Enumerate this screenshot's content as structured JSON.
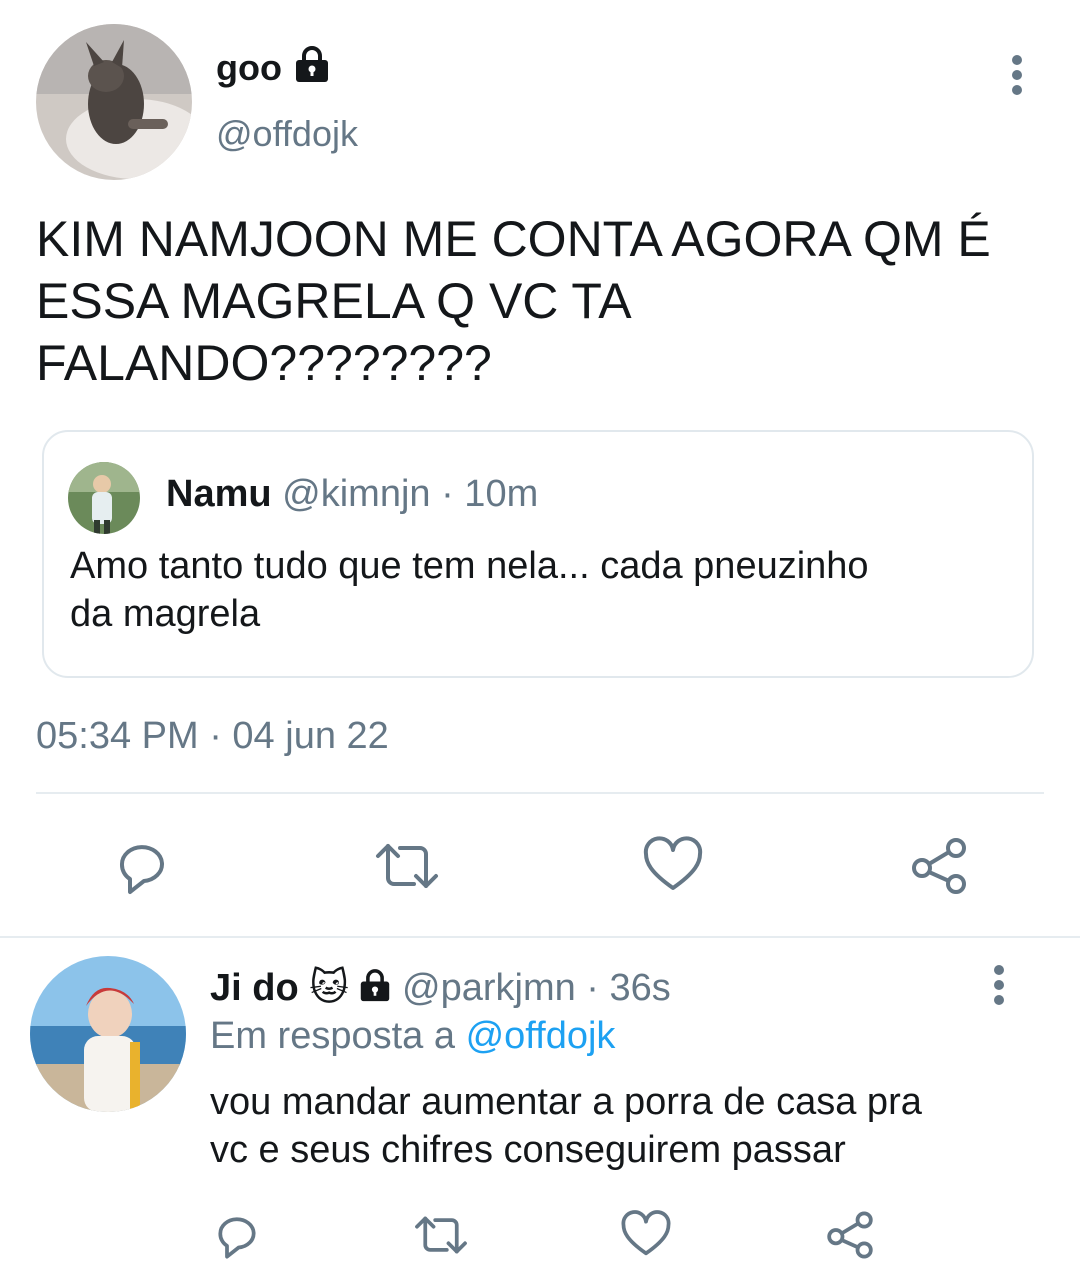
{
  "main_tweet": {
    "display_name": "goo",
    "handle": "@offdojk",
    "text_lines": [
      "KIM NAMJOON ME CONTA AGORA QM É",
      "ESSA MAGRELA Q VC TA",
      "FALANDO????????"
    ],
    "timestamp": "05:34 PM · 04 jun 22",
    "quoted": {
      "display_name": "Namu",
      "handle": "@kimnjn",
      "time": "· 10m",
      "text_lines": [
        "Amo tanto tudo que tem nela... cada pneuzinho",
        "da magrela"
      ]
    },
    "actions": [
      "reply-icon",
      "retweet-icon",
      "like-icon",
      "share-icon"
    ]
  },
  "reply_tweet": {
    "display_name": "Ji do",
    "emoji": "🐱",
    "handle": "@parkjmn",
    "time": "· 36s",
    "reply_prefix": "Em resposta a",
    "reply_to": "@offdojk",
    "text_lines": [
      "vou mandar aumentar a porra de casa pra",
      "vc e seus chifres conseguirem passar"
    ],
    "actions": [
      "reply-icon",
      "retweet-icon",
      "like-icon",
      "share-icon"
    ]
  },
  "colors": {
    "muted": "#657786",
    "link": "#1da1f2",
    "divider": "#e6ecf0",
    "text": "#14171a"
  }
}
